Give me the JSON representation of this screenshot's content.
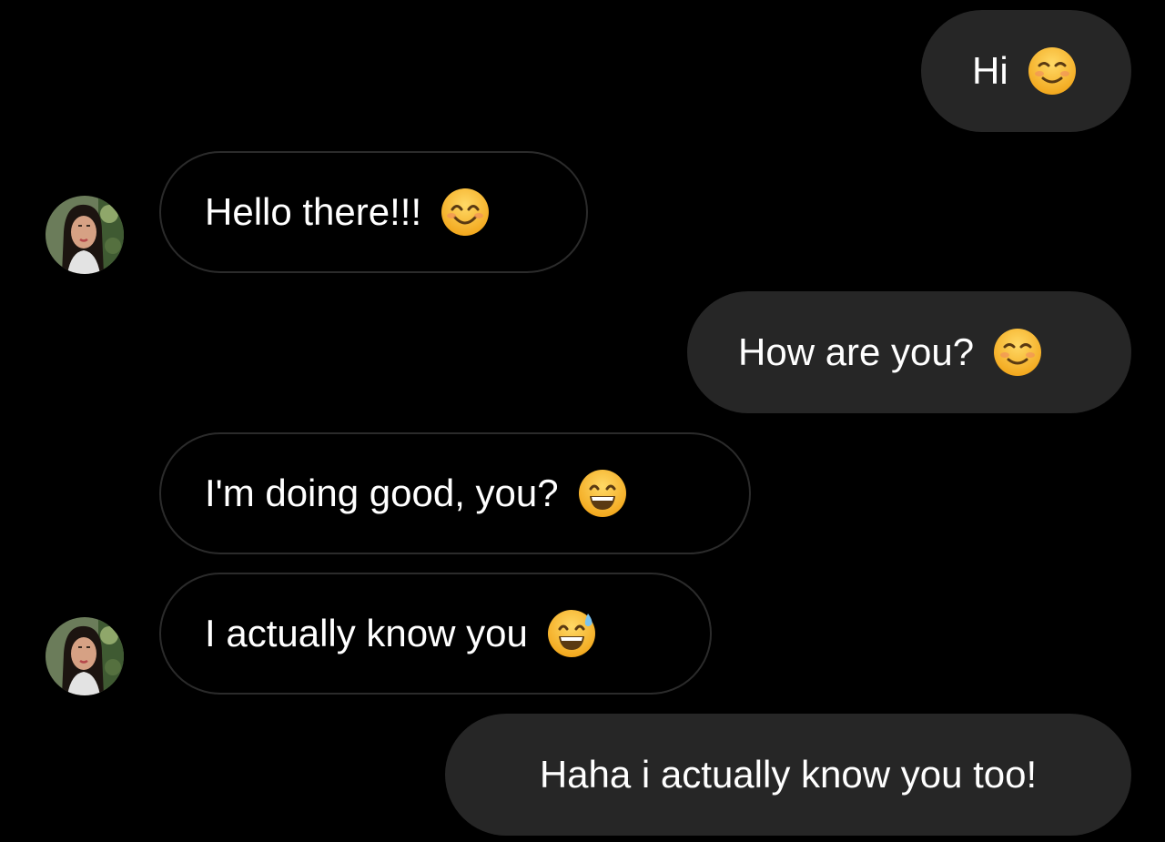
{
  "messages": [
    {
      "sender": "me",
      "text": "Hi",
      "emoji": "smiling-face-icon"
    },
    {
      "sender": "them",
      "text": "Hello there!!!",
      "emoji": "smiling-face-with-smiling-eyes-icon"
    },
    {
      "sender": "me",
      "text": "How are you?",
      "emoji": "smiling-face-icon"
    },
    {
      "sender": "them",
      "text": "I'm doing good, you?",
      "emoji": "grinning-face-icon"
    },
    {
      "sender": "them",
      "text": "I actually know you",
      "emoji": "grinning-face-with-sweat-icon"
    },
    {
      "sender": "me",
      "text": "Haha i actually know you too!"
    }
  ],
  "colors": {
    "background": "#000000",
    "sent_bubble": "#262626",
    "received_border": "#2b2b2b",
    "text": "#ffffff",
    "emoji_face": "#fbbf2f"
  }
}
